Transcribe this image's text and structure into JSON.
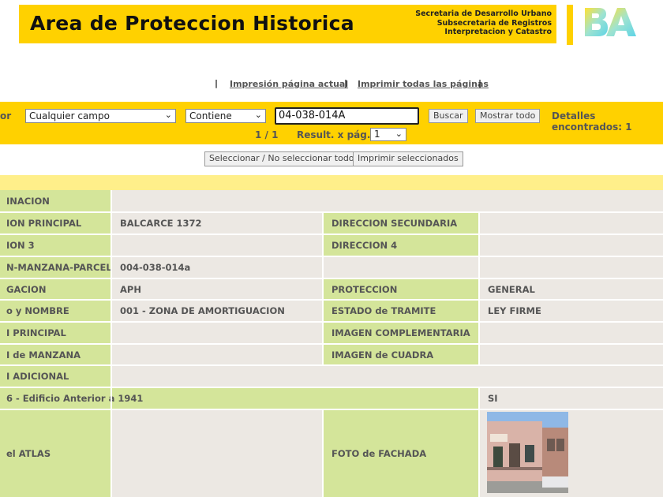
{
  "header": {
    "title": "Area de Proteccion Historica",
    "sub": [
      "Secretaria de Desarrollo Urbano",
      "Subsecretaria de Registros",
      "Interpretacion y Catastro"
    ],
    "logo": "BA",
    "brand_yellow": "#ffd100"
  },
  "print_links": {
    "sep": "|",
    "print_current": "Impresión página actual",
    "print_all": "Imprimir todas las páginas"
  },
  "search": {
    "label": "or",
    "field_select": "Cualquier campo",
    "op_select": "Contiene",
    "query": "04-038-014A",
    "search_btn": "Buscar",
    "show_all_btn": "Mostrar todo",
    "found_label": "Detalles encontrados: 1",
    "page_info": "1 / 1",
    "per_page_label": "Result. x pág.:",
    "per_page_value": "1"
  },
  "actions": {
    "toggle_select": "Seleccionar / No seleccionar todo",
    "print_selected": "Imprimir seleccionados"
  },
  "record": {
    "r1": {
      "l1": "INACION"
    },
    "r2": {
      "l1": "ION PRINCIPAL",
      "v1": "BALCARCE 1372",
      "l2": "DIRECCION SECUNDARIA",
      "v2": ""
    },
    "r3": {
      "l1": "ION 3",
      "v1": "",
      "l2": "DIRECCION 4",
      "v2": ""
    },
    "r4": {
      "l1": "N-MANZANA-PARCELA",
      "v1": "004-038-014a"
    },
    "r5": {
      "l1": "GACION",
      "v1": "APH",
      "l2": "PROTECCION",
      "v2": "GENERAL"
    },
    "r6": {
      "l1": "o y NOMBRE",
      "v1": "001 - ZONA DE AMORTIGUACION",
      "l2": "ESTADO de TRAMITE",
      "v2": "LEY FIRME"
    },
    "r7": {
      "l1": "I PRINCIPAL",
      "v1": "",
      "l2": "IMAGEN COMPLEMENTARIA",
      "v2": ""
    },
    "r8": {
      "l1": "I de MANZANA",
      "v1": "",
      "l2": "IMAGEN de CUADRA",
      "v2": ""
    },
    "r9": {
      "l1": "I ADICIONAL"
    },
    "r10": {
      "l1": "6 - Edificio Anterior a 1941",
      "v2": "SI"
    },
    "r11": {
      "l1": "el ATLAS",
      "v1": "",
      "l2": "FOTO de FACHADA"
    }
  }
}
